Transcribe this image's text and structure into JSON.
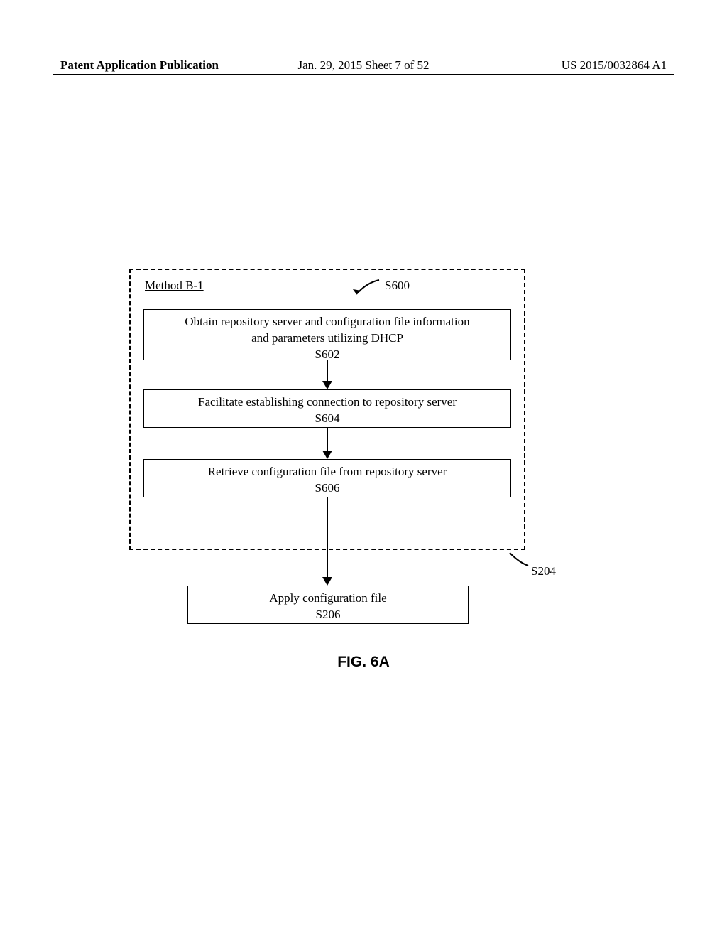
{
  "header": {
    "left": "Patent Application Publication",
    "center": "Jan. 29, 2015  Sheet 7 of 52",
    "right": "US 2015/0032864 A1"
  },
  "diagram": {
    "method_label": "Method B-1",
    "s600_label": "S600",
    "s204_label": "S204",
    "boxes": {
      "b602": {
        "line1": "Obtain repository server and configuration file information",
        "line2": "and parameters utilizing DHCP",
        "code": "S602"
      },
      "b604": {
        "line1": "Facilitate establishing connection to repository server",
        "code": "S604"
      },
      "b606": {
        "line1": "Retrieve configuration file from repository server",
        "code": "S606"
      },
      "b206": {
        "line1": "Apply configuration file",
        "code": "S206"
      }
    }
  },
  "figure_caption": "FIG. 6A"
}
